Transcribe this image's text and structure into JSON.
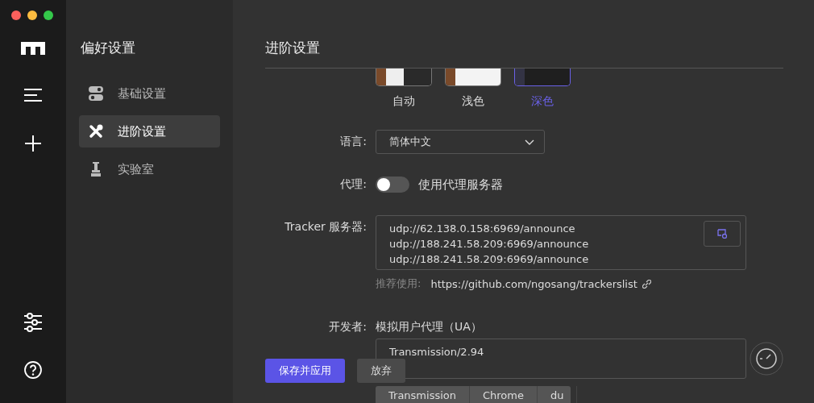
{
  "window": {
    "controls": [
      {
        "kind": "close"
      },
      {
        "kind": "minimize"
      },
      {
        "kind": "zoom"
      }
    ]
  },
  "rail": {
    "top": [
      {
        "kind": "logo"
      },
      {
        "kind": "menu"
      },
      {
        "kind": "add"
      }
    ],
    "bottom": [
      {
        "kind": "settings"
      },
      {
        "kind": "help"
      }
    ]
  },
  "sidebar": {
    "title": "偏好设置",
    "items": [
      {
        "label": "基础设置",
        "kind": "basic",
        "selected": false
      },
      {
        "label": "进阶设置",
        "kind": "advanced",
        "selected": true
      },
      {
        "label": "实验室",
        "kind": "lab",
        "selected": false
      }
    ]
  },
  "main": {
    "title": "进阶设置",
    "themes": [
      {
        "label": "自动",
        "kind": "auto",
        "selected": false
      },
      {
        "label": "浅色",
        "kind": "light",
        "selected": false
      },
      {
        "label": "深色",
        "kind": "dark",
        "selected": true
      }
    ],
    "language": {
      "label": "语言:",
      "value": "简体中文"
    },
    "proxy": {
      "label": "代理:",
      "on": false,
      "text": "使用代理服务器"
    },
    "tracker": {
      "label": "Tracker 服务器:",
      "lines": [
        "udp://62.138.0.158:6969/announce",
        "udp://188.241.58.209:6969/announce",
        "udp://188.241.58.209:6969/announce"
      ],
      "hint_label": "推荐使用:",
      "hint_link": "https://github.com/ngosang/trackerslist"
    },
    "developer": {
      "label": "开发者:",
      "title": "模拟用户代理（UA）",
      "value": "Transmission/2.94",
      "presets": [
        "Transmission",
        "Chrome",
        "du"
      ]
    },
    "buttons": [
      {
        "label": "保存并应用",
        "kind": "primary"
      },
      {
        "label": "放弃",
        "kind": "secondary"
      }
    ]
  }
}
